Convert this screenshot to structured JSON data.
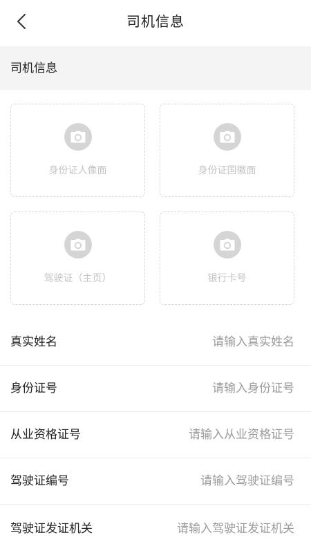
{
  "header": {
    "title": "司机信息",
    "back_icon": "chevron-left-icon"
  },
  "section": {
    "title": "司机信息"
  },
  "uploads": [
    {
      "label": "身份证人像面",
      "icon": "camera-icon"
    },
    {
      "label": "身份证国徽面",
      "icon": "camera-icon"
    },
    {
      "label": "驾驶证（主页）",
      "icon": "camera-icon"
    },
    {
      "label": "银行卡号",
      "icon": "camera-icon"
    }
  ],
  "form": {
    "fields": [
      {
        "label": "真实姓名",
        "value": "",
        "placeholder": "请输入真实姓名"
      },
      {
        "label": "身份证号",
        "value": "",
        "placeholder": "请输入身份证号"
      },
      {
        "label": "从业资格证号",
        "value": "",
        "placeholder": "请输入从业资格证号"
      },
      {
        "label": "驾驶证编号",
        "value": "",
        "placeholder": "请输入驾驶证编号"
      },
      {
        "label": "驾驶证发证机关",
        "value": "",
        "placeholder": "请输入驾驶证发证机关"
      }
    ]
  },
  "colors": {
    "page_background": "#ffffff",
    "section_background": "#f4f4f4",
    "text_primary": "#222222",
    "placeholder": "#9b9b9b",
    "upload_label": "#c4c4c4",
    "camera_circle": "#d5d5d5",
    "dashed_border": "#d7d7d7",
    "divider": "#ececec"
  }
}
